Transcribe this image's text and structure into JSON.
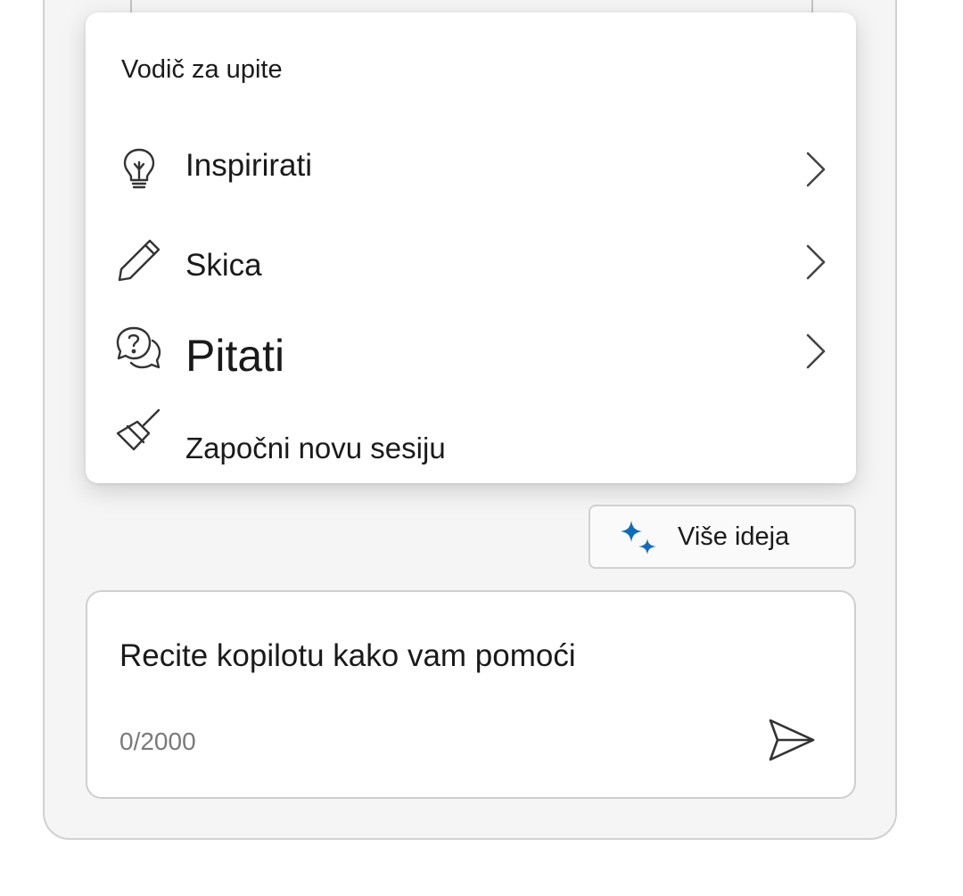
{
  "menu": {
    "title": "Vodič za upite",
    "items": [
      {
        "label": "Inspirirati",
        "icon": "lightbulb-icon"
      },
      {
        "label": "Skica",
        "icon": "pencil-icon"
      },
      {
        "label": "Pitati",
        "icon": "question-chat-icon"
      },
      {
        "label": "Započni novu sesiju",
        "icon": "broom-icon"
      }
    ]
  },
  "more_ideas": {
    "label": "Više ideja",
    "icon": "sparkle-icon",
    "accent": "#0f6cbd"
  },
  "composer": {
    "placeholder": "Recite kopilotu kako vam pomoći",
    "counter": "0/2000",
    "send_icon": "send-icon"
  }
}
